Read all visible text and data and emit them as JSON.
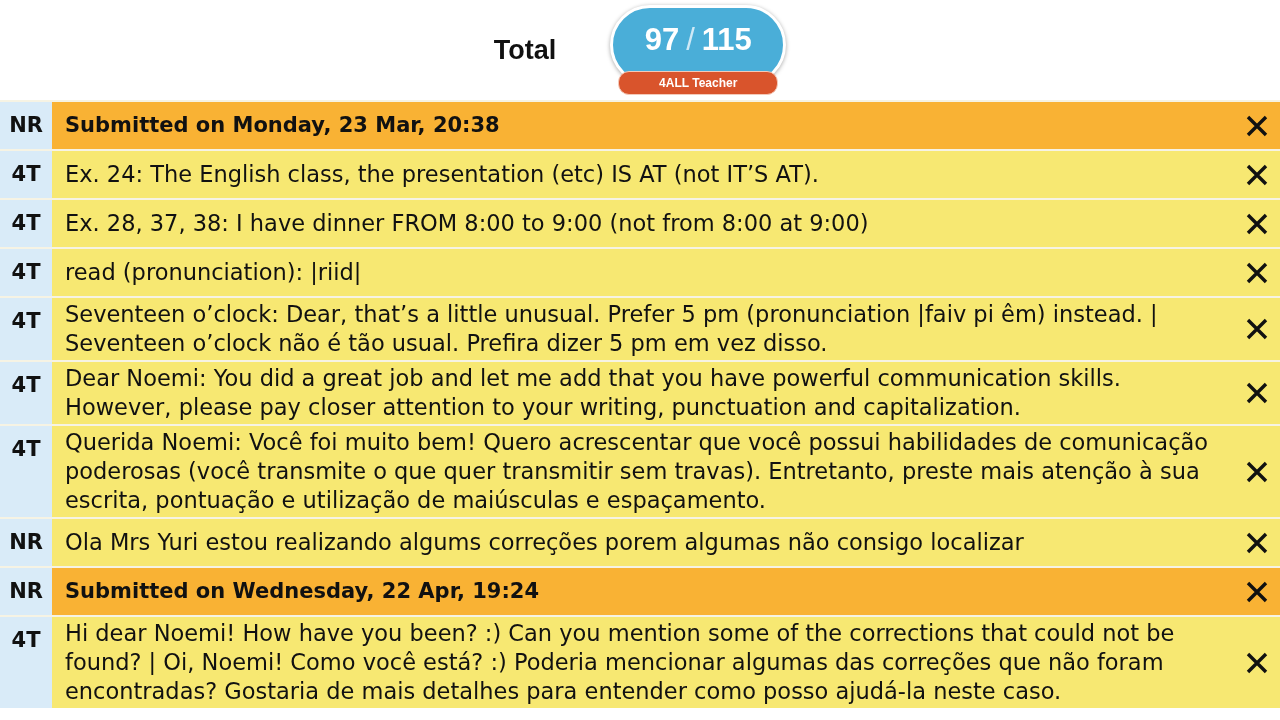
{
  "summary": {
    "label": "Total",
    "score": "97",
    "separator": "/",
    "max": "115",
    "badge": "4ALL Teacher"
  },
  "entries": [
    {
      "kind": "submission",
      "code": "NR",
      "text": "Submitted on Monday, 23 Mar, 20:38"
    },
    {
      "kind": "comment",
      "code": "4T",
      "text": "Ex. 24: The English class, the presentation (etc) IS AT (not IT’S AT)."
    },
    {
      "kind": "comment",
      "code": "4T",
      "text": "Ex. 28, 37, 38: I have dinner FROM 8:00 to 9:00 (not from 8:00 at 9:00)"
    },
    {
      "kind": "comment",
      "code": "4T",
      "text": "read (pronunciation): |riid|"
    },
    {
      "kind": "comment",
      "code": "4T",
      "text": "Seventeen o’clock: Dear, that’s a little unusual. Prefer 5 pm (pronunciation |faiv pi êm) instead. | Seventeen o’clock não é tão usual. Prefira dizer 5 pm em vez disso."
    },
    {
      "kind": "comment",
      "code": "4T",
      "text": "Dear Noemi: You did a great job and let me add that you have powerful communication skills. However, please pay closer attention to your writing, punctuation and capitalization."
    },
    {
      "kind": "comment",
      "code": "4T",
      "text": "Querida Noemi: Você foi muito bem! Quero acrescentar que você possui habilidades de comunicação poderosas (você transmite o que quer transmitir sem travas). Entretanto, preste mais atenção à sua escrita, pontuação e utilização de maiúsculas e espaçamento."
    },
    {
      "kind": "comment",
      "code": "NR",
      "text": "Ola Mrs Yuri estou realizando algums correções porem algumas não consigo localizar"
    },
    {
      "kind": "submission",
      "code": "NR",
      "text": "Submitted on Wednesday, 22 Apr, 19:24"
    },
    {
      "kind": "comment",
      "code": "4T",
      "text": "Hi dear Noemi! How have you been? :) Can you mention some of the corrections that could not be found? | Oi, Noemi! Como você está? :) Poderia mencionar algumas das correções que não foram encontradas? Gostaria de mais detalhes para entender como posso ajudá-la neste caso."
    }
  ]
}
